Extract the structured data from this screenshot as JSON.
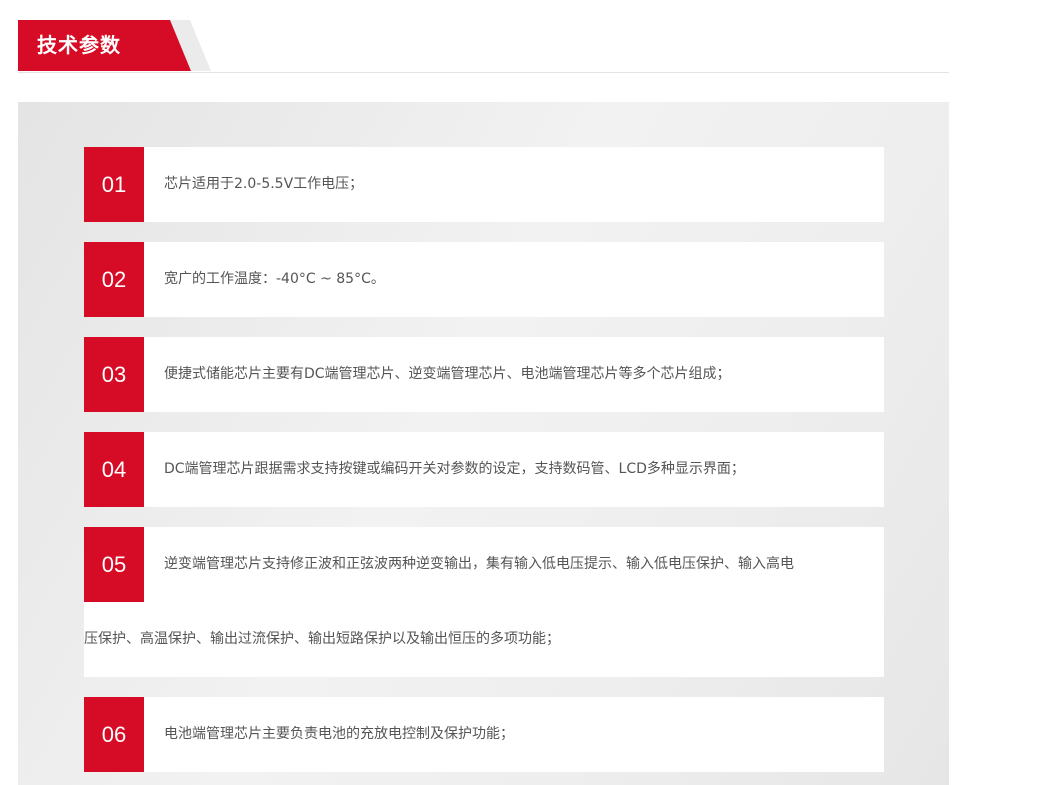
{
  "header": {
    "title": "技术参数",
    "accent_color": "#d60b25"
  },
  "items": [
    {
      "num": "01",
      "text": "芯片适用于2.0-5.5V工作电压；"
    },
    {
      "num": "02",
      "text": "宽广的工作温度：-40°C ~ 85°C。"
    },
    {
      "num": "03",
      "text": "便捷式储能芯片主要有DC端管理芯片、逆变端管理芯片、电池端管理芯片等多个芯片组成；"
    },
    {
      "num": "04",
      "text": "DC端管理芯片跟据需求支持按键或编码开关对参数的设定，支持数码管、LCD多种显示界面；"
    },
    {
      "num": "05",
      "text": "逆变端管理芯片支持修正波和正弦波两种逆变输出，集有输入低电压提示、输入低电压保护、输入高电",
      "text2": "压保护、高温保护、输出过流保护、输出短路保护以及输出恒压的多项功能；"
    },
    {
      "num": "06",
      "text": "电池端管理芯片主要负责电池的充放电控制及保护功能；"
    }
  ]
}
